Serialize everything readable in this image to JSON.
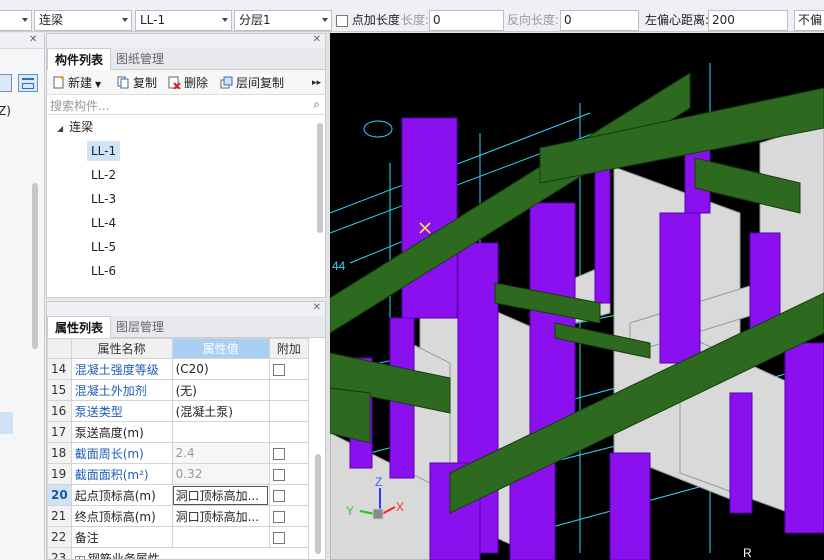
{
  "toolbar": {
    "type_select": "连梁",
    "component_select": "LL-1",
    "layer_select": "分层1",
    "point_length_label": "点加长度",
    "length_label": "长度:",
    "length_value": "0",
    "reverse_length_label": "反向长度:",
    "reverse_length_value": "0",
    "left_offset_label": "左偏心距离:",
    "left_offset_value": "200",
    "right_cutoff": "不偏"
  },
  "left_panel": {
    "fragment_text": "Z)"
  },
  "component_panel": {
    "tabs": [
      "构件列表",
      "图纸管理"
    ],
    "buttons": [
      "新建",
      "复制",
      "删除",
      "层间复制"
    ],
    "search_placeholder": "搜索构件...",
    "tree_root": "连梁",
    "items": [
      "LL-1",
      "LL-2",
      "LL-3",
      "LL-4",
      "LL-5",
      "LL-6"
    ],
    "selected": "LL-1"
  },
  "property_panel": {
    "tabs": [
      "属性列表",
      "图层管理"
    ],
    "headers": [
      "属性名称",
      "属性值",
      "附加"
    ],
    "rows": [
      {
        "num": "14",
        "name": "混凝土强度等级",
        "value": "(C20)"
      },
      {
        "num": "15",
        "name": "混凝土外加剂",
        "value": "(无)"
      },
      {
        "num": "16",
        "name": "泵送类型",
        "value": "(混凝土泵)"
      },
      {
        "num": "17",
        "name": "泵送高度(m)",
        "value": ""
      },
      {
        "num": "18",
        "name": "截面周长(m)",
        "value": "2.4"
      },
      {
        "num": "19",
        "name": "截面面积(m²)",
        "value": "0.32"
      },
      {
        "num": "20",
        "name": "起点顶标高(m)",
        "value": "洞口顶标高加..."
      },
      {
        "num": "21",
        "name": "终点顶标高(m)",
        "value": "洞口顶标高加..."
      },
      {
        "num": "22",
        "name": "备注",
        "value": ""
      },
      {
        "num": "23",
        "name": "钢筋业务属性",
        "value": ""
      }
    ]
  },
  "viewport": {
    "axis_z": "Z",
    "axis_y": "Y",
    "axis_x": "X",
    "corner_text": "44",
    "bottom_letter": "R",
    "colors": {
      "beam": "#2d6a1f",
      "column": "#8a10f0",
      "wall": "#d9d9d9",
      "grid": "#2fd7ff"
    }
  }
}
